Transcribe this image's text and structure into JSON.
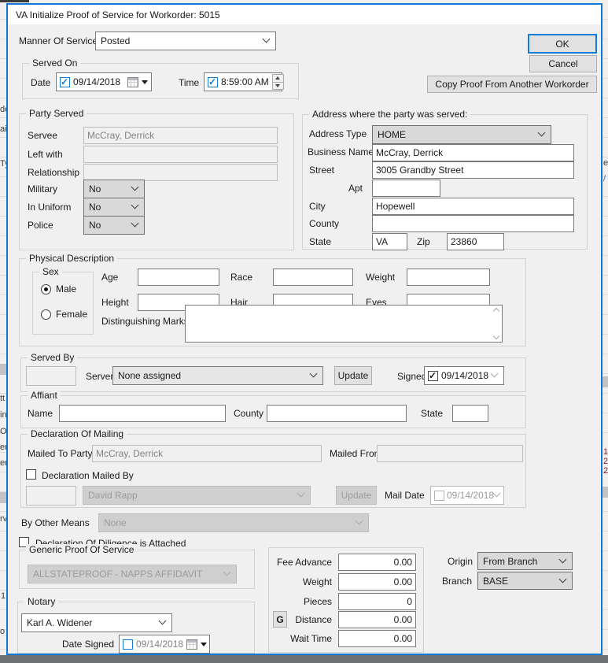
{
  "title": "VA Initialize Proof of Service for Workorder: 5015",
  "manner_of_service": {
    "label": "Manner Of Service",
    "value": "Posted"
  },
  "actions": {
    "ok": "OK",
    "cancel": "Cancel",
    "copy_proof": "Copy Proof From Another Workorder"
  },
  "served_on": {
    "title": "Served On",
    "date_label": "Date",
    "date": "09/14/2018",
    "time_label": "Time",
    "time": "8:59:00 AM"
  },
  "party_served": {
    "title": "Party Served",
    "servee_label": "Servee",
    "servee": "McCray, Derrick",
    "left_with_label": "Left with",
    "left_with": "",
    "relationship_label": "Relationship",
    "relationship": "",
    "military_label": "Military",
    "military": "No",
    "in_uniform_label": "In Uniform",
    "in_uniform": "No",
    "police_label": "Police",
    "police": "No"
  },
  "address": {
    "title": "Address where the party was served:",
    "type_label": "Address Type",
    "type": "HOME",
    "business_label": "Business Name",
    "business": "McCray, Derrick",
    "street_label": "Street",
    "street": "3005 Grandby Street",
    "apt_label": "Apt",
    "apt": "",
    "city_label": "City",
    "city": "Hopewell",
    "county_label": "County",
    "county": "",
    "state_label": "State",
    "state": "VA",
    "zip_label": "Zip",
    "zip": "23860"
  },
  "physical": {
    "title": "Physical Description",
    "sex_title": "Sex",
    "male": "Male",
    "female": "Female",
    "selected_sex": "Male",
    "age_label": "Age",
    "age": "",
    "race_label": "Race",
    "race": "",
    "weight_label": "Weight",
    "weight": "",
    "height_label": "Height",
    "height": "",
    "hair_label": "Hair",
    "hair": "",
    "eyes_label": "Eyes",
    "eyes": "",
    "marks_label": "Distinguishing Marks",
    "marks": ""
  },
  "served_by": {
    "title": "Served By",
    "server_label": "Server",
    "server": "None assigned",
    "update": "Update",
    "signed_label": "Signed",
    "signed_date": "09/14/2018"
  },
  "affiant": {
    "title": "Affiant",
    "name_label": "Name",
    "name": "",
    "county_label": "County",
    "county": "",
    "state_label": "State",
    "state": ""
  },
  "mailing": {
    "title": "Declaration Of Mailing",
    "mailed_to_label": "Mailed To Party",
    "mailed_to": "McCray, Derrick",
    "mailed_from_label": "Mailed From",
    "mailed_from": "",
    "mailed_by_label": "Declaration Mailed By",
    "mailer": "David Rapp",
    "update": "Update",
    "mail_date_label": "Mail Date",
    "mail_date": "09/14/2018"
  },
  "other_means": {
    "label": "By Other Means",
    "value": "None"
  },
  "diligence": {
    "label": "Declaration Of Diligence is Attached"
  },
  "generic_proof": {
    "title": "Generic Proof Of Service",
    "value": "ALLSTATEPROOF - NAPPS AFFIDAVIT"
  },
  "notary": {
    "title": "Notary",
    "value": "Karl A. Widener",
    "date_signed_label": "Date Signed",
    "date_signed": "09/14/2018"
  },
  "fees": {
    "fee_advance_label": "Fee Advance",
    "fee_advance": "0.00",
    "weight_label": "Weight",
    "weight": "0.00",
    "pieces_label": "Pieces",
    "pieces": "0",
    "g_button": "G",
    "distance_label": "Distance",
    "distance": "0.00",
    "wait_time_label": "Wait Time",
    "wait_time": "0.00"
  },
  "origin": {
    "label": "Origin",
    "value": "From Branch"
  },
  "branch": {
    "label": "Branch",
    "value": "BASE"
  },
  "background": {
    "left_fragments": [
      "de",
      "ai",
      "Ty",
      "tt",
      "in",
      "O",
      "er",
      "er",
      "rv",
      "1",
      "o"
    ],
    "right_fragments": [
      "e",
      "/",
      "1",
      "2",
      "2"
    ]
  },
  "colors": {
    "accent": "#0f7cd5",
    "dialog_bg": "#f0f0f0",
    "titlebar_bg": "#ffffff",
    "disabled_text": "#838383"
  }
}
